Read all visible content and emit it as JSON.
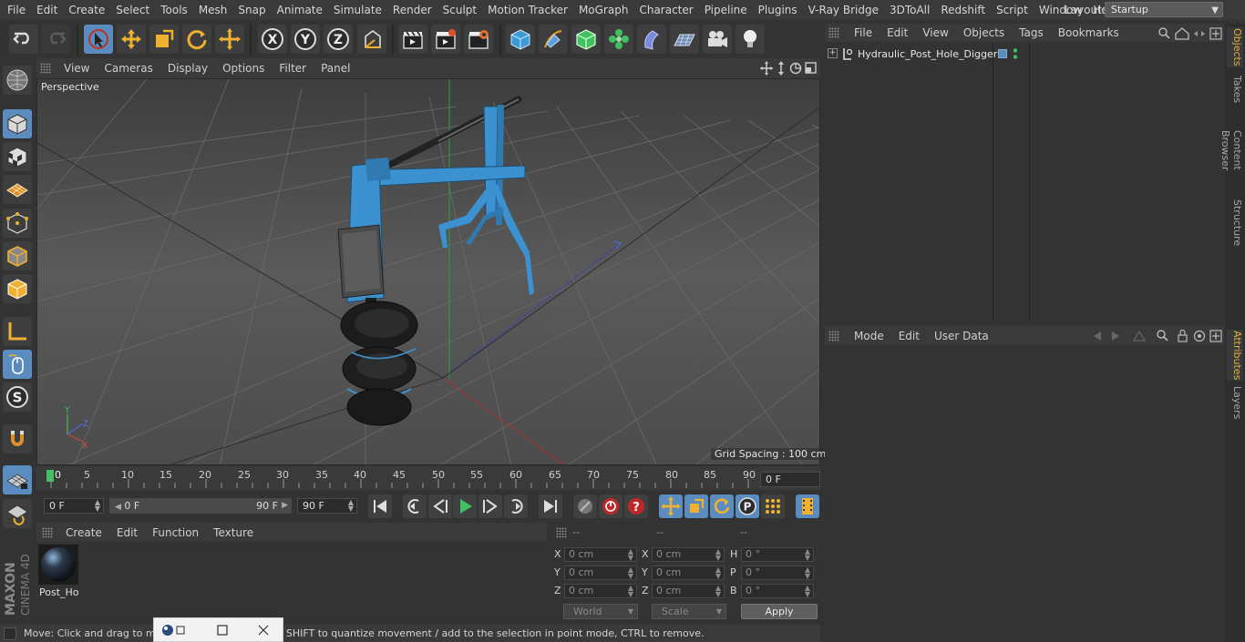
{
  "menubar": {
    "items": [
      "File",
      "Edit",
      "Create",
      "Select",
      "Tools",
      "Mesh",
      "Snap",
      "Animate",
      "Simulate",
      "Render",
      "Sculpt",
      "Motion Tracker",
      "MoGraph",
      "Character",
      "Pipeline",
      "Plugins",
      "V-Ray Bridge",
      "3DToAll",
      "Redshift",
      "Script",
      "Window",
      "Help"
    ],
    "layout_label": "Layout:",
    "layout_value": "Startup"
  },
  "viewport": {
    "menu": [
      "View",
      "Cameras",
      "Display",
      "Options",
      "Filter",
      "Panel"
    ],
    "camera_label": "Perspective",
    "grid_spacing": "Grid Spacing : 100 cm"
  },
  "timeline": {
    "ticks": [
      "0",
      "5",
      "10",
      "15",
      "20",
      "25",
      "30",
      "35",
      "40",
      "45",
      "50",
      "55",
      "60",
      "65",
      "70",
      "75",
      "80",
      "85",
      "90"
    ],
    "current_frame": "0 F",
    "start_field": "0 F",
    "range_start": "0 F",
    "range_end": "90 F",
    "end_field": "90 F"
  },
  "material_manager": {
    "menu": [
      "Create",
      "Edit",
      "Function",
      "Texture"
    ],
    "materials": [
      {
        "name": "Post_Ho"
      }
    ]
  },
  "coordinates": {
    "headers": [
      "--",
      "--",
      "--"
    ],
    "rows": [
      {
        "p_label": "X",
        "p_value": "0 cm",
        "s_label": "X",
        "s_value": "0 cm",
        "r_label": "H",
        "r_value": "0 °"
      },
      {
        "p_label": "Y",
        "p_value": "0 cm",
        "s_label": "Y",
        "s_value": "0 cm",
        "r_label": "P",
        "r_value": "0 °"
      },
      {
        "p_label": "Z",
        "p_value": "0 cm",
        "s_label": "Z",
        "s_value": "0 cm",
        "r_label": "B",
        "r_value": "0 °"
      }
    ],
    "space_select": "World",
    "mode_select": "Scale",
    "apply_label": "Apply"
  },
  "status": {
    "text": "Move: Click and drag to move elements. Hold down SHIFT to quantize movement / add to the selection in point mode, CTRL to remove."
  },
  "object_manager": {
    "menu": [
      "File",
      "Edit",
      "View",
      "Objects",
      "Tags",
      "Bookmarks"
    ],
    "objects": [
      {
        "name": "Hydraulic_Post_Hole_Digger"
      }
    ]
  },
  "attribute_manager": {
    "menu": [
      "Mode",
      "Edit",
      "User Data"
    ]
  },
  "side_tabs": [
    "Objects",
    "Takes",
    "Content Browser",
    "Structure",
    "Attributes",
    "Layers"
  ],
  "brand": {
    "line1": "MAXON",
    "line2": "CINEMA 4D"
  },
  "colors": {
    "accent": "#5a8cc0",
    "active_tab": "#e0b040",
    "model_blue": "#3c92d0"
  }
}
